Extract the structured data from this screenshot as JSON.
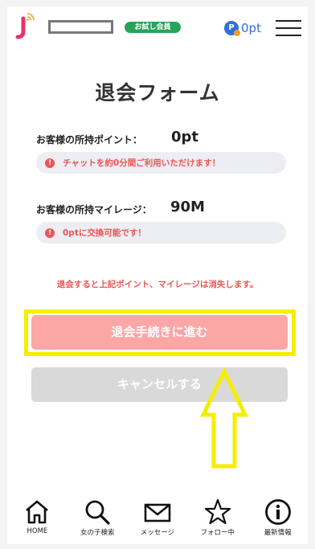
{
  "header": {
    "member_badge": "お試し会員",
    "points": "0pt"
  },
  "page_title": "退会フォーム",
  "points_row": {
    "label": "お客様の所持ポイント：",
    "value": "0pt",
    "notice": "チャットを約0分間ご利用いただけます！"
  },
  "mileage_row": {
    "label": "お客様の所持マイレージ：",
    "value": "90M",
    "notice": "0ptに交換可能です！"
  },
  "warning_text": "退会すると上記ポイント、マイレージは消失します。",
  "buttons": {
    "withdraw": "退会手続きに進む",
    "cancel": "キャンセルする"
  },
  "bottom_nav": [
    {
      "label": "HOME",
      "icon": "home-icon"
    },
    {
      "label": "女の子検索",
      "icon": "search-icon"
    },
    {
      "label": "メッセージ",
      "icon": "mail-icon"
    },
    {
      "label": "フォロー中",
      "icon": "star-icon"
    },
    {
      "label": "最新情報",
      "icon": "info-icon"
    }
  ],
  "colors": {
    "accent_red": "#ee5555",
    "withdraw_button": "#fca6a6",
    "cancel_button": "#d9d9d9",
    "badge_green": "#2aa35a",
    "points_blue": "#2f6fd6",
    "highlight_yellow": "#f5ee00"
  }
}
